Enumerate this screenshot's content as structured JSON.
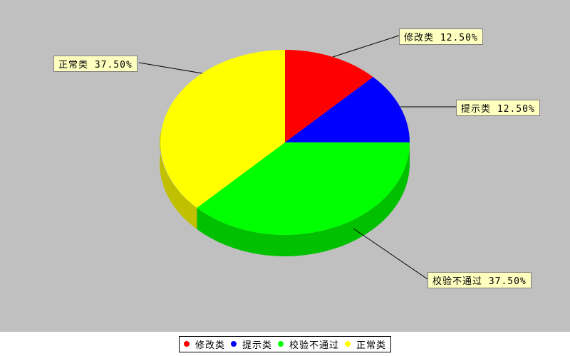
{
  "chart_data": {
    "type": "pie",
    "title": "",
    "series": [
      {
        "name": "修改类",
        "value": 12.5,
        "percent_label": "12.50%",
        "color": "#ff0000"
      },
      {
        "name": "提示类",
        "value": 12.5,
        "percent_label": "12.50%",
        "color": "#0000ff"
      },
      {
        "name": "校验不通过",
        "value": 37.5,
        "percent_label": "37.50%",
        "color": "#00ff00"
      },
      {
        "name": "正常类",
        "value": 37.5,
        "percent_label": "37.50%",
        "color": "#ffff00"
      }
    ],
    "legend_position": "bottom",
    "start_angle_deg": 90
  },
  "labels": {
    "s0": "修改类 12.50%",
    "s1": "提示类 12.50%",
    "s2": "校验不通过 37.50%",
    "s3": "正常类 37.50%"
  },
  "legend": {
    "i0": "修改类",
    "i1": "提示类",
    "i2": "校验不通过",
    "i3": "正常类"
  },
  "colors": {
    "s0": "#ff0000",
    "s1": "#0000ff",
    "s2": "#00ff00",
    "s3": "#ffff00",
    "s0_dark": "#c00000",
    "s2_dark": "#00c000",
    "s3_dark": "#c0c000"
  }
}
